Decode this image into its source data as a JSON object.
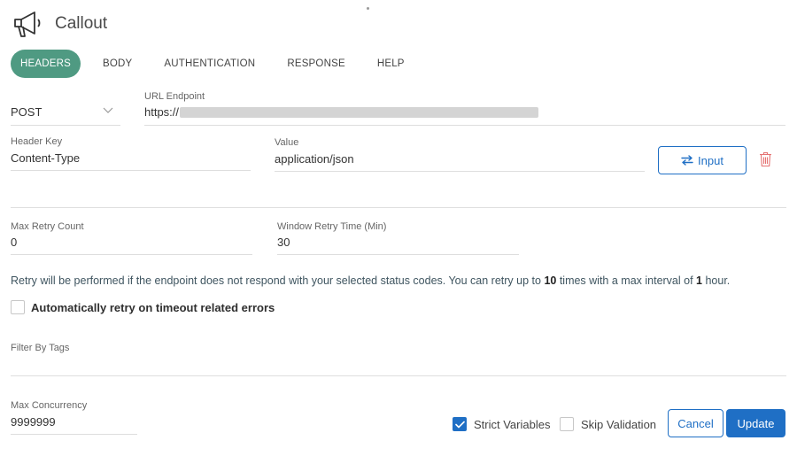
{
  "title": "Callout",
  "icons": {
    "title": "megaphone-icon",
    "method_dropdown": "chevron-down-icon",
    "input_button": "swap-arrows-icon",
    "delete": "trash-icon",
    "checkbox_check": "checkmark-icon"
  },
  "tabs": [
    {
      "label": "HEADERS",
      "active": true
    },
    {
      "label": "BODY",
      "active": false
    },
    {
      "label": "AUTHENTICATION",
      "active": false
    },
    {
      "label": "RESPONSE",
      "active": false
    },
    {
      "label": "HELP",
      "active": false
    }
  ],
  "request": {
    "method": "POST",
    "url_label": "URL Endpoint",
    "url_value": "https://"
  },
  "header_row": {
    "key_label": "Header Key",
    "key_value": "Content-Type",
    "value_label": "Value",
    "value_value": "application/json",
    "input_button_label": "Input"
  },
  "retry": {
    "max_count_label": "Max Retry Count",
    "max_count_value": "0",
    "window_label": "Window Retry Time (Min)",
    "window_value": "30",
    "note_prefix": "Retry will be performed if the endpoint does not respond with your selected status codes. You can retry up to ",
    "note_times": "10",
    "note_middle": " times with a max interval of ",
    "note_hours": "1",
    "note_suffix": " hour.",
    "auto_retry_label": "Automatically retry on timeout related errors",
    "auto_retry_checked": false
  },
  "filter_tags_label": "Filter By Tags",
  "concurrency": {
    "label": "Max Concurrency",
    "value": "9999999"
  },
  "options": {
    "strict_label": "Strict Variables",
    "strict_checked": true,
    "skip_label": "Skip Validation",
    "skip_checked": false
  },
  "buttons": {
    "cancel": "Cancel",
    "update": "Update"
  },
  "colors": {
    "active_tab": "#4f9a82",
    "primary": "#1f6fc5",
    "delete_icon": "#e57373"
  }
}
